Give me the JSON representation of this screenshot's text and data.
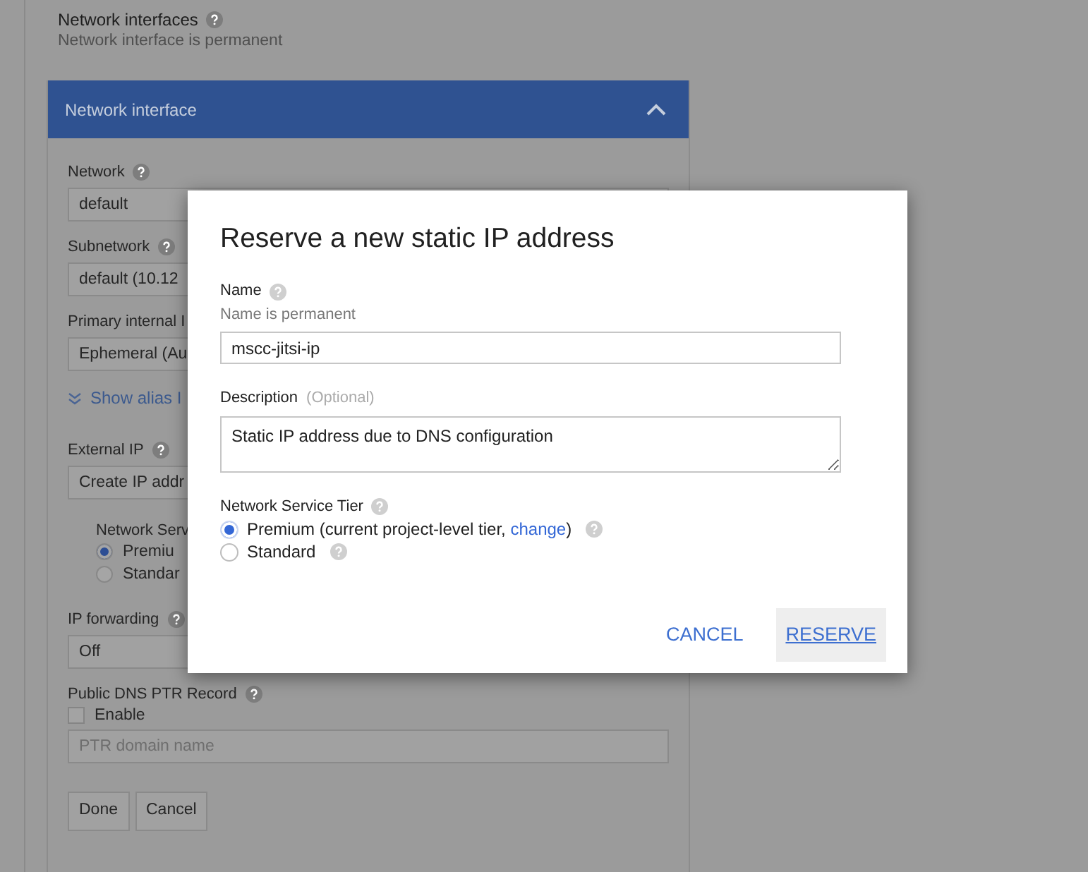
{
  "section": {
    "title": "Network interfaces",
    "help": true,
    "subtitle": "Network interface is permanent"
  },
  "panel": {
    "title": "Network interface",
    "expanded": true,
    "items": [
      {
        "kind": "select",
        "label": "Network",
        "help": true,
        "value": "default"
      },
      {
        "kind": "select",
        "label": "Subnetwork",
        "help": true,
        "value": "default (10.12"
      },
      {
        "kind": "select",
        "label": "Primary internal I",
        "value": "Ephemeral (Au"
      },
      {
        "kind": "link",
        "text": "Show alias I"
      },
      {
        "kind": "select",
        "label": "External IP",
        "help": true,
        "value": "Create IP addr"
      },
      {
        "kind": "radios",
        "label": "Network Serv",
        "options": [
          {
            "label": "Premiu",
            "selected": true
          },
          {
            "label": "Standar",
            "selected": false
          }
        ]
      },
      {
        "kind": "dropdown",
        "label": "IP forwarding",
        "help": true,
        "value": "Off"
      },
      {
        "kind": "checkbox",
        "label": "Public DNS PTR Record",
        "help": true,
        "option": "Enable",
        "checked": false,
        "placeholder": "PTR domain name"
      }
    ],
    "buttons": [
      "Done",
      "Cancel"
    ]
  },
  "dialog": {
    "title": "Reserve a new static IP address",
    "name": {
      "label": "Name",
      "help": true,
      "hint": "Name is permanent",
      "value": "mscc-jitsi-ip"
    },
    "description": {
      "label": "Description",
      "note": "(Optional)",
      "value": "Static IP address due to DNS configuration"
    },
    "tier": {
      "label": "Network Service Tier",
      "help": true,
      "options": [
        {
          "text": "Premium (current project-level tier, ",
          "link": "change",
          "after": ")",
          "help": true,
          "selected": true
        },
        {
          "text": "Standard",
          "help": true,
          "selected": false
        }
      ]
    },
    "actions": [
      {
        "label": "CANCEL",
        "focused": false
      },
      {
        "label": "RESERVE",
        "focused": true
      }
    ]
  }
}
